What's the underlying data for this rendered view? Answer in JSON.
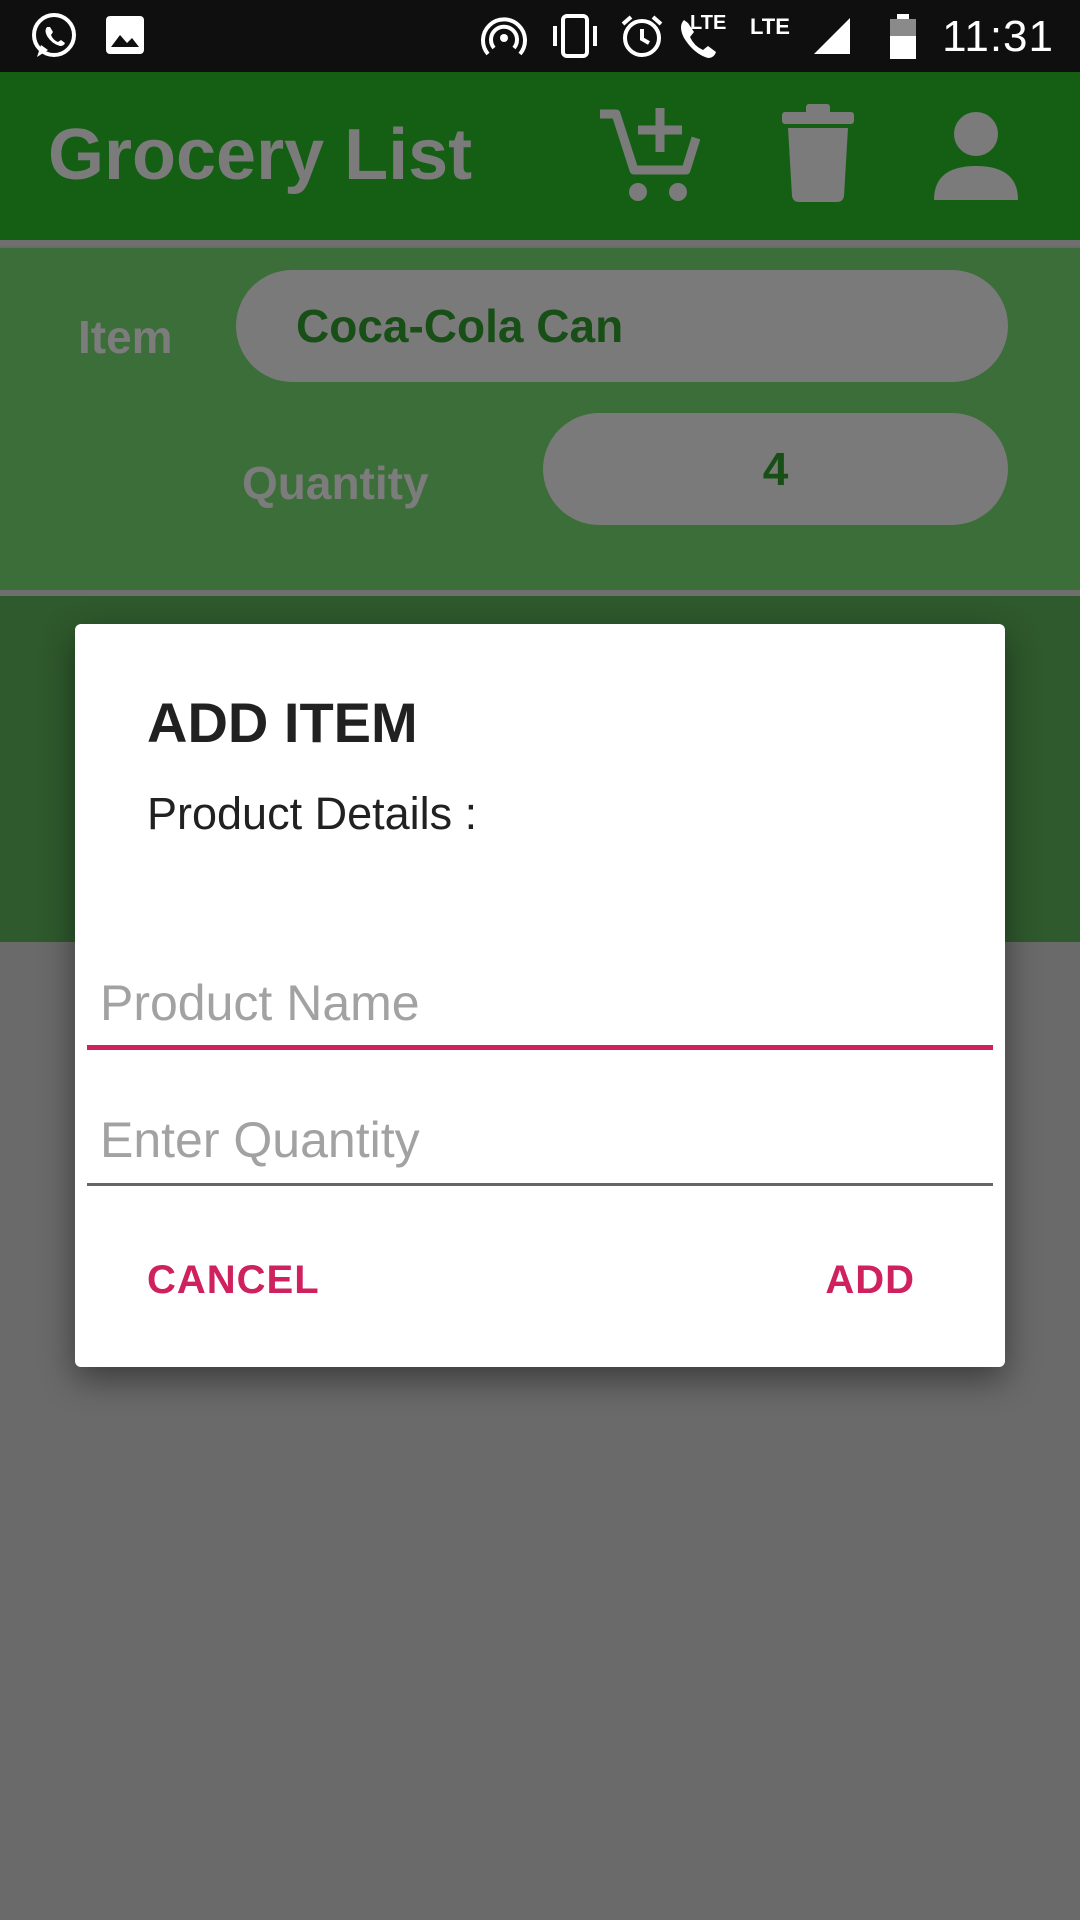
{
  "status_bar": {
    "time": "11:31",
    "lte1": "LTE",
    "lte2": "LTE",
    "icons": [
      "whatsapp-icon",
      "image-icon",
      "hotspot-icon",
      "vibrate-icon",
      "alarm-icon",
      "volte-call-icon",
      "signal-icon",
      "battery-icon"
    ]
  },
  "app_bar": {
    "title": "Grocery List",
    "actions": [
      "add-to-cart-icon",
      "delete-icon",
      "account-icon"
    ]
  },
  "form": {
    "item_label": "Item",
    "item_value": "Coca-Cola Can",
    "quantity_label": "Quantity",
    "quantity_value": "4"
  },
  "dialog": {
    "title": "ADD ITEM",
    "message": "Product Details :",
    "product_name_placeholder": "Product Name",
    "quantity_placeholder": "Enter Quantity",
    "cancel_label": "CANCEL",
    "add_label": "ADD"
  },
  "colors": {
    "accent": "#d0215f",
    "app_bar": "#145f14",
    "scrim_background": "#6a6a6a"
  }
}
